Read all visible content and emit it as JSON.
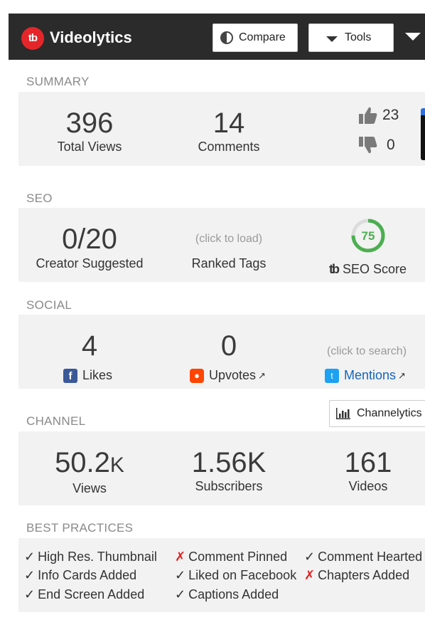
{
  "header": {
    "logo_text": "tb",
    "title": "Videolytics",
    "compare_label": "Compare",
    "tools_label": "Tools",
    "icons": [
      "contrast-icon",
      "caret-down-icon",
      "menu-caret-icon"
    ]
  },
  "summary": {
    "label": "SUMMARY",
    "views_value": "396",
    "views_caption": "Total Views",
    "comments_value": "14",
    "comments_caption": "Comments",
    "likes_count": "23",
    "dislikes_count": "0"
  },
  "seo": {
    "label": "SEO",
    "suggested_value": "0/20",
    "suggested_caption": "Creator Suggested",
    "ranked_hint": "(click to load)",
    "ranked_caption": "Ranked Tags",
    "score_value": "75",
    "score_percent": 75,
    "score_caption": "SEO Score",
    "score_color": "#4caf50"
  },
  "social": {
    "label": "SOCIAL",
    "likes_value": "4",
    "likes_caption": "Likes",
    "upvotes_value": "0",
    "upvotes_caption": "Upvotes",
    "mentions_hint": "(click to search)",
    "mentions_caption": "Mentions",
    "mentions_color": "#1565c0"
  },
  "channel": {
    "label": "CHANNEL",
    "button_label": "Channelytics",
    "views_value": "50.2",
    "views_suffix": "K",
    "views_caption": "Views",
    "subscribers_value": "1.56K",
    "subscribers_caption": "Subscribers",
    "videos_value": "161",
    "videos_caption": "Videos"
  },
  "best_practices": {
    "label": "BEST PRACTICES",
    "items": [
      {
        "mark": "✓",
        "text": "High Res. Thumbnail",
        "ok": true
      },
      {
        "mark": "✗",
        "text": "Comment Pinned",
        "ok": false
      },
      {
        "mark": "✓",
        "text": "Comment Hearted",
        "ok": true
      },
      {
        "mark": "✓",
        "text": "Info Cards Added",
        "ok": true
      },
      {
        "mark": "✓",
        "text": "Liked on Facebook",
        "ok": true
      },
      {
        "mark": "✗",
        "text": "Chapters Added",
        "ok": false
      },
      {
        "mark": "✓",
        "text": "End Screen Added",
        "ok": true
      },
      {
        "mark": "✓",
        "text": "Captions Added",
        "ok": true
      }
    ]
  },
  "colors": {
    "header_bg": "#2b2b2b",
    "brand_red": "#e4262b",
    "card_bg": "#f2f2f2",
    "section_label": "#8a8a8a"
  }
}
